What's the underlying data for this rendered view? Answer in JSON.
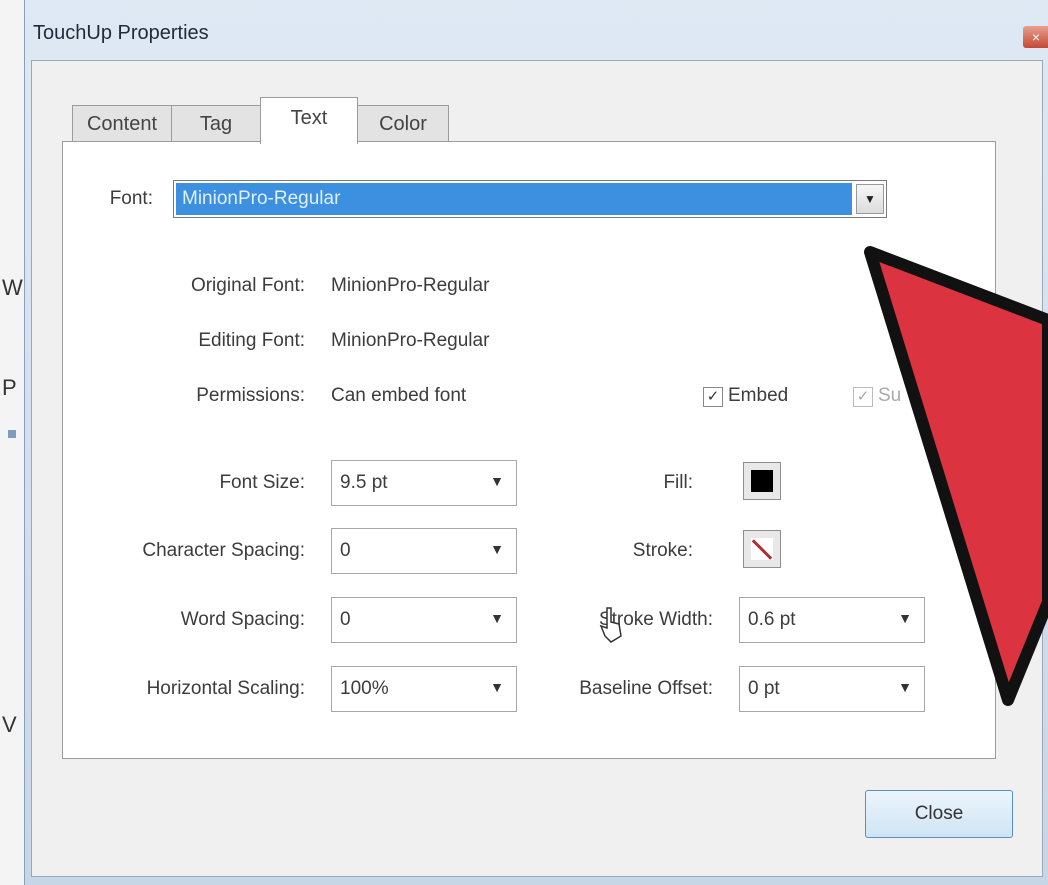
{
  "window": {
    "title": "TouchUp Properties",
    "close_glyph": "×"
  },
  "tabs": [
    {
      "label": "Content",
      "active": false
    },
    {
      "label": "Tag",
      "active": false
    },
    {
      "label": "Text",
      "active": true
    },
    {
      "label": "Color",
      "active": false
    }
  ],
  "font": {
    "label": "Font:",
    "value": "MinionPro-Regular"
  },
  "info": {
    "original_font_label": "Original Font:",
    "original_font_value": "MinionPro-Regular",
    "editing_font_label": "Editing Font:",
    "editing_font_value": "MinionPro-Regular",
    "permissions_label": "Permissions:",
    "permissions_value": "Can embed font"
  },
  "embed": {
    "label": "Embed",
    "checked": true
  },
  "subset": {
    "label": "Su",
    "checked": true,
    "enabled": false
  },
  "left_fields": [
    {
      "label": "Font Size:",
      "value": "9.5 pt"
    },
    {
      "label": "Character Spacing:",
      "value": "0"
    },
    {
      "label": "Word Spacing:",
      "value": "0"
    },
    {
      "label": "Horizontal Scaling:",
      "value": "100%"
    }
  ],
  "fill": {
    "label": "Fill:",
    "color": "#000000"
  },
  "stroke": {
    "label": "Stroke:",
    "color": "none"
  },
  "stroke_width": {
    "label": "Stroke Width:",
    "value": "0.6 pt"
  },
  "baseline_offset": {
    "label": "Baseline Offset:",
    "value": "0 pt"
  },
  "buttons": {
    "close": "Close"
  },
  "icons": {
    "dropdown": "▼",
    "check": "✓"
  },
  "colors": {
    "selection": "#3d8fe0",
    "arrow": "#dc3340"
  }
}
